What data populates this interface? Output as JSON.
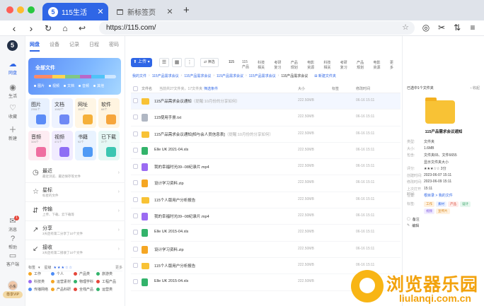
{
  "browser": {
    "tabs": [
      {
        "logo": "5",
        "title": "115生活",
        "active": true
      },
      {
        "icon": "new-tab-page-icon",
        "title": "新标签页",
        "active": false
      }
    ],
    "url": "https://115.com/",
    "colors": {
      "accent": "#2f66e6",
      "close": "#fe5f57",
      "min": "#febc2e",
      "max": "#28c840"
    }
  },
  "rail": {
    "logo": "5",
    "items": [
      {
        "icon": "cloud-icon",
        "label": "网盘",
        "active": true
      },
      {
        "icon": "life-icon",
        "label": "生活"
      },
      {
        "icon": "heart-icon",
        "label": "收藏"
      },
      {
        "icon": "plus-icon",
        "label": "新建"
      }
    ],
    "bottom": [
      {
        "icon": "message-icon",
        "label": "消息",
        "badge": "1"
      },
      {
        "icon": "help-icon",
        "label": "帮助"
      },
      {
        "icon": "client-icon",
        "label": "客户端"
      }
    ],
    "user": "小东",
    "vip": "尊享VIP"
  },
  "sidebar": {
    "tabs": [
      "网盘",
      "设备",
      "记录",
      "日程",
      "密码"
    ],
    "storage": {
      "title": "全部文件",
      "legend": [
        "图片",
        "视频",
        "文档",
        "音频",
        "其他"
      ],
      "used_fraction": 0.86
    },
    "categories": [
      {
        "name": "图片",
        "sub": "2351个",
        "bg": "#e8f1ff",
        "glyph": "#5b8cf7"
      },
      {
        "name": "文档",
        "sub": "1082个",
        "bg": "#eef3ff",
        "glyph": "#6f89f5"
      },
      {
        "name": "网址",
        "sub": "153个",
        "bg": "#fff6e5",
        "glyph": "#f5b03a"
      },
      {
        "name": "软件",
        "sub": "68个",
        "bg": "#fff4e0",
        "glyph": "#f6a53b"
      },
      {
        "name": "音频",
        "sub": "326个",
        "bg": "#fdecf2",
        "glyph": "#ef6ea0"
      },
      {
        "name": "视频",
        "sub": "471个",
        "bg": "#f1ecff",
        "glyph": "#8f6ef5"
      },
      {
        "name": "书籍",
        "sub": "92个",
        "bg": "#e9f3ff",
        "glyph": "#4f9af5"
      },
      {
        "name": "已下载",
        "sub": "37个",
        "bg": "#e6f8f5",
        "glyph": "#3cc6b1"
      }
    ],
    "items": [
      {
        "icon": "clock-icon",
        "name": "最近",
        "desc": "最近浏览、最近保存等文件"
      },
      {
        "icon": "star-icon",
        "name": "星标",
        "desc": "标星的文件"
      },
      {
        "icon": "transfer-icon",
        "name": "传输",
        "desc": "上传、下载、云下载等"
      },
      {
        "icon": "share-icon",
        "name": "分享",
        "desc": "3天后有第二分享了10个文件"
      },
      {
        "icon": "receive-icon",
        "name": "接收",
        "desc": "3天后有第二接收了10个文件"
      }
    ],
    "footer": {
      "label": "标签",
      "rating_label": "星级",
      "rating": 3,
      "more": "更多"
    },
    "tags": [
      {
        "name": "工作",
        "color": "#f5a623"
      },
      {
        "name": "个人",
        "color": "#4d8cf5"
      },
      {
        "name": "产品类",
        "color": "#e5463a"
      },
      {
        "name": "旅游类",
        "color": "#33b36b"
      },
      {
        "name": "科技类",
        "color": "#9b6bf2"
      },
      {
        "name": "运营素材",
        "color": "#f5a623"
      },
      {
        "name": "物理学科",
        "color": "#33b36b"
      },
      {
        "name": "工程产品",
        "color": "#e5463a"
      },
      {
        "name": "传播网络",
        "color": "#4d8cf5"
      },
      {
        "name": "产品科研",
        "color": "#f5a623"
      },
      {
        "name": "全栈产品",
        "color": "#e5463a"
      },
      {
        "name": "运营类",
        "color": "#33b36b"
      }
    ]
  },
  "main": {
    "upload": "上传",
    "filter": "筛选",
    "quick_tabs": [
      "115",
      "115产品",
      "科技相关",
      "考研复习",
      "产品规划",
      "电影资源",
      "科技相关",
      "考研复习",
      "产品规划",
      "电影资源",
      "更多"
    ],
    "breadcrumb": [
      "我的文件",
      "115产品需求会议",
      "115产品需求会议",
      "115产品需求会议",
      "115产品需求会议",
      "115产品需求会议"
    ],
    "new_folder": "新建文件夹",
    "header": {
      "name": "文件名",
      "info": "当前共27文件夹，17文件夹",
      "filter": "筛选条件",
      "size": "大小",
      "tag": "标签",
      "time": "修改时间"
    },
    "rows": [
      {
        "type": "folder",
        "name": "115产品需求会议通知",
        "sub": "（提醒:10月份的分享如何）",
        "size": "222.50MB",
        "tag": "",
        "time": "06-16 15:11"
      },
      {
        "type": "txt",
        "name": "115使用手册.txt",
        "sub": "",
        "size": "222.50MB",
        "tag": "",
        "time": "06-16 15:11"
      },
      {
        "type": "folder",
        "name": "115产品需求会议通知[相与会人员信息表]",
        "sub": "（提醒:10月份的分享如何）",
        "size": "222.50MB",
        "tag": "",
        "time": "06-16 15:11"
      },
      {
        "type": "xls",
        "name": "Elle UK 2021-04.xls",
        "sub": "",
        "size": "222.50MB",
        "tag": "",
        "time": "06-16 15:11"
      },
      {
        "type": "mp4",
        "name": "我的幸福时光09--08纪录片.mp4",
        "sub": "",
        "size": "222.50MB",
        "tag": "",
        "time": "06-16 15:11"
      },
      {
        "type": "zip",
        "name": "设计学习资料.zip",
        "sub": "",
        "size": "222.50MB",
        "tag": "",
        "time": "06-16 15:11"
      },
      {
        "type": "folder",
        "name": "115个人版用户分析报告",
        "sub": "",
        "size": "222.50MB",
        "tag": "",
        "time": "06-16 15:11"
      },
      {
        "type": "mp4",
        "name": "我的幸福时光09--08纪录片.mp4",
        "sub": "",
        "size": "222.50MB",
        "tag": "",
        "time": "06-16 15:11"
      },
      {
        "type": "xls",
        "name": "Elle UK 2015-04.xls",
        "sub": "",
        "size": "222.50MB",
        "tag": "",
        "time": "06-16 15:11"
      },
      {
        "type": "zip",
        "name": "设计学习资料.zip",
        "sub": "",
        "size": "222.50MB",
        "tag": "",
        "time": "06-16 15:11"
      },
      {
        "type": "folder",
        "name": "115个人版用户分析报告",
        "sub": "",
        "size": "222.50MB",
        "tag": "",
        "time": "06-16 15:11"
      },
      {
        "type": "xls",
        "name": "Elle UK 2015-04.xls",
        "sub": "",
        "size": "222.50MB",
        "tag": "",
        "time": "06-16 15:11"
      }
    ]
  },
  "detail": {
    "header": "已选中1个文件夹",
    "collapse": "收起",
    "title": "115产品需求会议通知",
    "info": [
      {
        "k": "类型:",
        "v": "文件夹"
      },
      {
        "k": "大小:",
        "v": "1.6MB"
      },
      {
        "k": "包含:",
        "v": "文件夹65、文件6655"
      },
      {
        "k": "",
        "v": "显示文件夹大小"
      },
      {
        "k": "评分:",
        "v": "★★★☆☆ 3分"
      },
      {
        "k": "创建时间:",
        "v": "2023-06-07 15:11"
      },
      {
        "k": "修改时间:",
        "v": "2023-06-09 15:11"
      },
      {
        "k": "上次打开时间:",
        "v": "15:11"
      },
      {
        "k": "位置:",
        "v": "根目录 > 我的文件",
        "link": true
      }
    ],
    "tags_label": "标签:",
    "chips": [
      {
        "t": "工作",
        "bg": "#fff1df",
        "c": "#d8861a"
      },
      {
        "t": "素材",
        "bg": "#eef3ff",
        "c": "#2f66e6"
      },
      {
        "t": "产品",
        "bg": "#ffecea",
        "c": "#d84b3a"
      },
      {
        "t": "设计",
        "bg": "#e6f7ee",
        "c": "#2b9b5c"
      },
      {
        "t": "视频",
        "bg": "#f1ecff",
        "c": "#7b55e0"
      },
      {
        "t": "宣传片",
        "bg": "#fff1df",
        "c": "#d8861a"
      }
    ],
    "note": "备注",
    "edit": "编辑"
  },
  "watermark": {
    "cn": "浏览器乐园",
    "en": "liulanqi.com.cn"
  }
}
